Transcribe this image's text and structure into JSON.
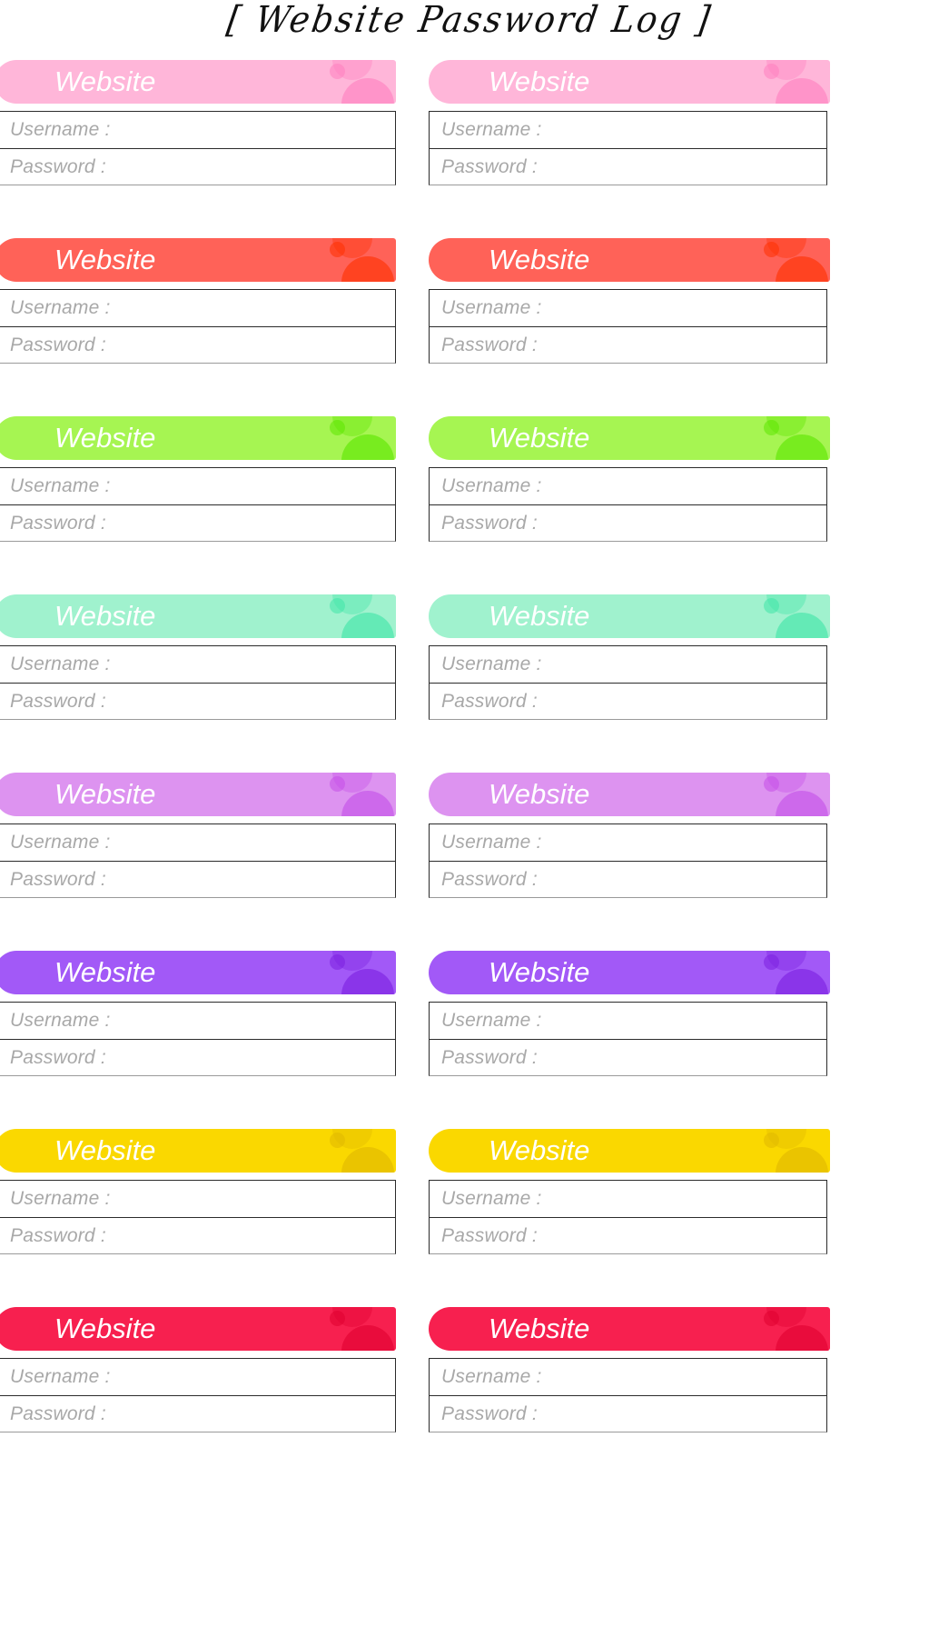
{
  "page": {
    "title": "[ Website Password Log ]",
    "background_color": "#FFFFFF"
  },
  "labels": {
    "website": "Website",
    "username": "Username :",
    "password": "Password :"
  },
  "cards": [
    {
      "color": "#FFB6D9",
      "accent": "#FF7FBF",
      "website_label": "Website",
      "username_label": "Username :",
      "password_label": "Password :"
    },
    {
      "color": "#FFB6D9",
      "accent": "#FF7FBF",
      "website_label": "Website",
      "username_label": "Username :",
      "password_label": "Password :"
    },
    {
      "color": "#FF6258",
      "accent": "#FF3000",
      "website_label": "Website",
      "username_label": "Username :",
      "password_label": "Password :"
    },
    {
      "color": "#FF6258",
      "accent": "#FF3000",
      "website_label": "Website",
      "username_label": "Username :",
      "password_label": "Password :"
    },
    {
      "color": "#A6F552",
      "accent": "#5CE600",
      "website_label": "Website",
      "username_label": "Username :",
      "password_label": "Password :"
    },
    {
      "color": "#A6F552",
      "accent": "#5CE600",
      "website_label": "Website",
      "username_label": "Username :",
      "password_label": "Password :"
    },
    {
      "color": "#A0F2CE",
      "accent": "#3FE5A8",
      "website_label": "Website",
      "username_label": "Username :",
      "password_label": "Password :"
    },
    {
      "color": "#A0F2CE",
      "accent": "#3FE5A8",
      "website_label": "Website",
      "username_label": "Username :",
      "password_label": "Password :"
    },
    {
      "color": "#DD93F0",
      "accent": "#C44FE8",
      "website_label": "Website",
      "username_label": "Username :",
      "password_label": "Password :"
    },
    {
      "color": "#DD93F0",
      "accent": "#C44FE8",
      "website_label": "Website",
      "username_label": "Username :",
      "password_label": "Password :"
    },
    {
      "color": "#A259F7",
      "accent": "#7B1FE0",
      "website_label": "Website",
      "username_label": "Username :",
      "password_label": "Password :"
    },
    {
      "color": "#A259F7",
      "accent": "#7B1FE0",
      "website_label": "Website",
      "username_label": "Username :",
      "password_label": "Password :"
    },
    {
      "color": "#FAD800",
      "accent": "#E0B800",
      "website_label": "Website",
      "username_label": "Username :",
      "password_label": "Password :"
    },
    {
      "color": "#FAD800",
      "accent": "#E0B800",
      "website_label": "Website",
      "username_label": "Username :",
      "password_label": "Password :"
    },
    {
      "color": "#F7204F",
      "accent": "#E00030",
      "website_label": "Website",
      "username_label": "Username :",
      "password_label": "Password :"
    },
    {
      "color": "#F7204F",
      "accent": "#E00030",
      "website_label": "Website",
      "username_label": "Username :",
      "password_label": "Password :"
    }
  ]
}
